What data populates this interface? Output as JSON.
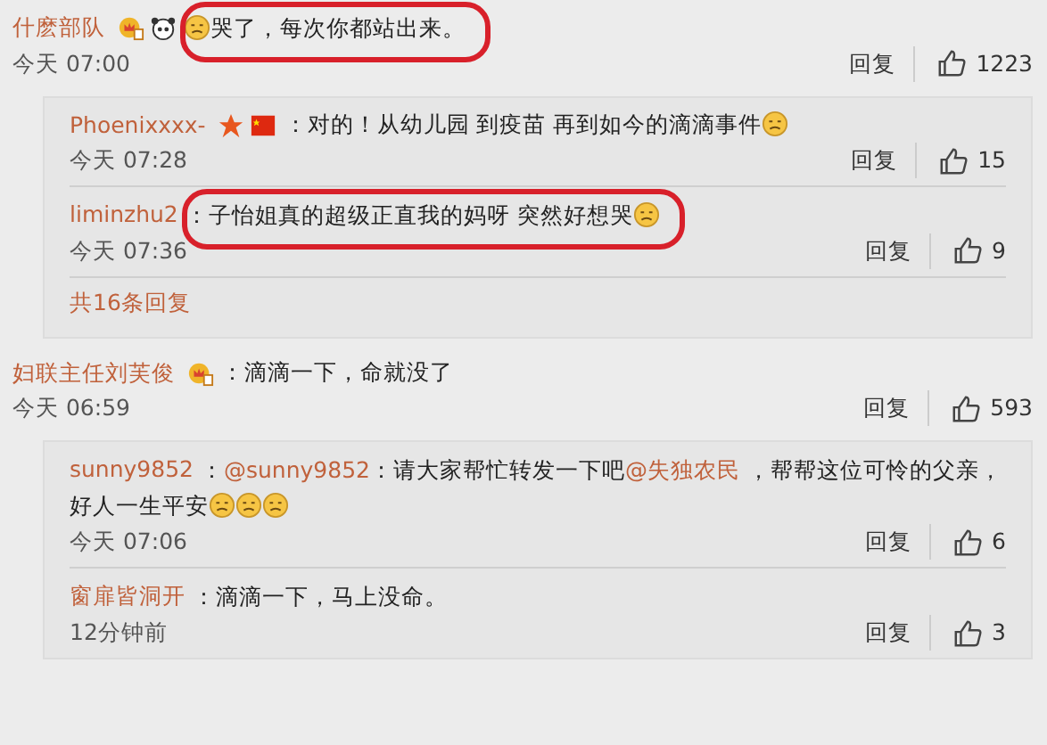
{
  "comments": [
    {
      "user": "什麽部队",
      "badges": [
        {
          "kind": "crown"
        },
        {
          "kind": "panda"
        }
      ],
      "highlighted": true,
      "segments": [
        {
          "kind": "emoji"
        },
        {
          "kind": "text",
          "text": "哭了，每次你都站出来。"
        }
      ],
      "time": "今天 07:00",
      "reply_label": "回复",
      "likes": "1223",
      "replies": [
        {
          "user": "Phoenixxxx-",
          "badges": [
            {
              "kind": "star"
            },
            {
              "kind": "flag"
            }
          ],
          "segments": [
            {
              "kind": "text",
              "text": "：对的！从幼儿园 到疫苗 再到如今的滴滴事件"
            },
            {
              "kind": "emoji"
            }
          ],
          "time": "今天 07:28",
          "reply_label": "回复",
          "likes": "15"
        },
        {
          "user": "liminzhu2",
          "highlighted": true,
          "segments": [
            {
              "kind": "text",
              "text": "：子怡姐真的超级正直我的妈呀  突然好想哭"
            },
            {
              "kind": "emoji"
            }
          ],
          "time": "今天 07:36",
          "reply_label": "回复",
          "likes": "9"
        }
      ],
      "more": "共16条回复"
    },
    {
      "user": "妇联主任刘芙俊",
      "badges": [
        {
          "kind": "crown"
        }
      ],
      "segments": [
        {
          "kind": "text",
          "text": "：滴滴一下，命就没了"
        }
      ],
      "time": "今天 06:59",
      "reply_label": "回复",
      "likes": "593",
      "replies": [
        {
          "user": "sunny9852",
          "segments": [
            {
              "kind": "text",
              "text": "："
            },
            {
              "kind": "mention",
              "text": "@sunny9852"
            },
            {
              "kind": "text",
              "text": "：请大家帮忙转发一下吧"
            },
            {
              "kind": "mention",
              "text": "@失独农民"
            },
            {
              "kind": "text",
              "text": " ，帮帮这位可怜的父亲，好人一生平安"
            },
            {
              "kind": "emoji"
            },
            {
              "kind": "emoji"
            },
            {
              "kind": "emoji"
            }
          ],
          "time": "今天 07:06",
          "reply_label": "回复",
          "likes": "6"
        },
        {
          "user": "窗扉皆洞开",
          "segments": [
            {
              "kind": "text",
              "text": "：滴滴一下，马上没命。"
            }
          ],
          "time": "12分钟前",
          "reply_label": "回复",
          "likes": "3"
        }
      ]
    }
  ]
}
